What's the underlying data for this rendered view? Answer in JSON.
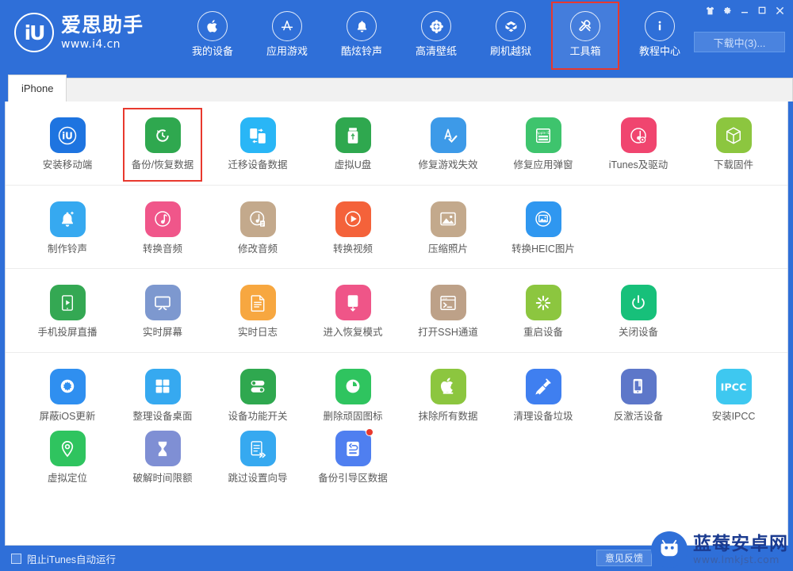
{
  "window": {
    "titlebar_buttons": [
      {
        "name": "skin",
        "glyph": "skin-icon"
      },
      {
        "name": "settings",
        "glyph": "gear-icon"
      },
      {
        "name": "minimize",
        "glyph": "minimize-icon"
      },
      {
        "name": "maximize",
        "glyph": "maximize-icon"
      },
      {
        "name": "close",
        "glyph": "close-icon"
      }
    ],
    "download_button": "下载中(3)..."
  },
  "brand": {
    "mark": "iU",
    "title": "爱思助手",
    "url": "www.i4.cn"
  },
  "nav": {
    "items": [
      {
        "label": "我的设备",
        "icon": "apple-icon",
        "active": false
      },
      {
        "label": "应用游戏",
        "icon": "appstore-icon",
        "active": false
      },
      {
        "label": "酷炫铃声",
        "icon": "bell-icon",
        "active": false
      },
      {
        "label": "高清壁纸",
        "icon": "flower-icon",
        "active": false
      },
      {
        "label": "刷机越狱",
        "icon": "box-icon",
        "active": false
      },
      {
        "label": "工具箱",
        "icon": "toolbox-icon",
        "active": true
      },
      {
        "label": "教程中心",
        "icon": "info-icon",
        "active": false
      }
    ]
  },
  "tabs": [
    {
      "label": "iPhone",
      "active": true
    }
  ],
  "toolbox": {
    "groups": [
      {
        "id": "group-1",
        "tools": [
          {
            "label": "安装移动端",
            "icon": "i4-app-icon",
            "color": "#1e74e0",
            "highlight": false,
            "badge": false
          },
          {
            "label": "备份/恢复数据",
            "icon": "backup-restore-icon",
            "color": "#2fa84f",
            "highlight": true,
            "badge": false
          },
          {
            "label": "迁移设备数据",
            "icon": "migrate-device-icon",
            "color": "#29b6f6",
            "highlight": false,
            "badge": false
          },
          {
            "label": "虚拟U盘",
            "icon": "usb-drive-icon",
            "color": "#2fa84f",
            "highlight": false,
            "badge": false
          },
          {
            "label": "修复游戏失效",
            "icon": "fix-game-icon",
            "color": "#3d9ae8",
            "highlight": false,
            "badge": false
          },
          {
            "label": "修复应用弹窗",
            "icon": "appleid-popup-icon",
            "color": "#3ec46d",
            "highlight": false,
            "badge": false
          },
          {
            "label": "iTunes及驱动",
            "icon": "itunes-driver-icon",
            "color": "#f0456f",
            "highlight": false,
            "badge": false
          },
          {
            "label": "下载固件",
            "icon": "firmware-box-icon",
            "color": "#8cc63f",
            "highlight": false,
            "badge": false
          }
        ]
      },
      {
        "id": "group-2",
        "tools": [
          {
            "label": "制作铃声",
            "icon": "make-ringtone-icon",
            "color": "#36a9f0",
            "highlight": false,
            "badge": false
          },
          {
            "label": "转换音频",
            "icon": "convert-audio-icon",
            "color": "#f0568a",
            "highlight": false,
            "badge": false
          },
          {
            "label": "修改音频",
            "icon": "edit-audio-icon",
            "color": "#c3a98c",
            "highlight": false,
            "badge": false
          },
          {
            "label": "转换视频",
            "icon": "convert-video-icon",
            "color": "#f4623a",
            "highlight": false,
            "badge": false
          },
          {
            "label": "压缩照片",
            "icon": "compress-photo-icon",
            "color": "#c3a98c",
            "highlight": false,
            "badge": false
          },
          {
            "label": "转换HEIC图片",
            "icon": "convert-heic-icon",
            "color": "#2f97f0",
            "highlight": false,
            "badge": false
          }
        ]
      },
      {
        "id": "group-3",
        "tools": [
          {
            "label": "手机投屏直播",
            "icon": "screen-cast-icon",
            "color": "#34a853",
            "highlight": false,
            "badge": false
          },
          {
            "label": "实时屏幕",
            "icon": "live-screen-icon",
            "color": "#7d98cf",
            "highlight": false,
            "badge": false
          },
          {
            "label": "实时日志",
            "icon": "live-log-icon",
            "color": "#f7a740",
            "highlight": false,
            "badge": false
          },
          {
            "label": "进入恢复模式",
            "icon": "recovery-mode-icon",
            "color": "#ef5588",
            "highlight": false,
            "badge": false
          },
          {
            "label": "打开SSH通道",
            "icon": "ssh-tunnel-icon",
            "color": "#bda188",
            "highlight": false,
            "badge": false
          },
          {
            "label": "重启设备",
            "icon": "restart-device-icon",
            "color": "#8cc63f",
            "highlight": false,
            "badge": false
          },
          {
            "label": "关闭设备",
            "icon": "power-off-icon",
            "color": "#17c07a",
            "highlight": false,
            "badge": false
          }
        ]
      },
      {
        "id": "group-4",
        "tools": [
          {
            "label": "屏蔽iOS更新",
            "icon": "block-ios-update-icon",
            "color": "#2f8ff0",
            "highlight": false,
            "badge": false
          },
          {
            "label": "整理设备桌面",
            "icon": "organize-desktop-icon",
            "color": "#36a9f0",
            "highlight": false,
            "badge": false
          },
          {
            "label": "设备功能开关",
            "icon": "feature-toggle-icon",
            "color": "#2fa84f",
            "highlight": false,
            "badge": false
          },
          {
            "label": "删除顽固图标",
            "icon": "delete-icon-icon",
            "color": "#2fc45f",
            "highlight": false,
            "badge": false
          },
          {
            "label": "抹除所有数据",
            "icon": "erase-all-icon",
            "color": "#8cc63f",
            "highlight": false,
            "badge": false
          },
          {
            "label": "清理设备垃圾",
            "icon": "clean-junk-icon",
            "color": "#3f7ff0",
            "highlight": false,
            "badge": false
          },
          {
            "label": "反激活设备",
            "icon": "deactivate-device-icon",
            "color": "#5d77c9",
            "highlight": false,
            "badge": false
          },
          {
            "label": "安装IPCC",
            "icon": "ipcc-icon",
            "color": "#3ec8f0",
            "highlight": false,
            "badge": false
          },
          {
            "label": "虚拟定位",
            "icon": "virtual-location-icon",
            "color": "#2fc45f",
            "highlight": false,
            "badge": false
          },
          {
            "label": "破解时间限额",
            "icon": "time-limit-icon",
            "color": "#7f8fd4",
            "highlight": false,
            "badge": false
          },
          {
            "label": "跳过设置向导",
            "icon": "skip-setup-icon",
            "color": "#36a9f0",
            "highlight": false,
            "badge": false
          },
          {
            "label": "备份引导区数据",
            "icon": "backup-boot-icon",
            "color": "#4f7ff0",
            "highlight": false,
            "badge": true
          }
        ]
      }
    ]
  },
  "statusbar": {
    "checkbox_label": "阻止iTunes自动运行",
    "checkbox_checked": false,
    "feedback_button": "意见反馈"
  },
  "watermark": {
    "title": "蓝莓安卓网",
    "url": "www.lmkjst.com"
  }
}
